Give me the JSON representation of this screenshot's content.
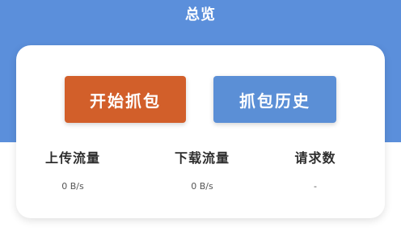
{
  "header": {
    "title": "总览"
  },
  "actions": {
    "start_capture_label": "开始抓包",
    "capture_history_label": "抓包历史"
  },
  "stats": {
    "upload": {
      "label": "上传流量",
      "value": "0 B/s"
    },
    "download": {
      "label": "下载流量",
      "value": "0 B/s"
    },
    "requests": {
      "label": "请求数",
      "value": "-"
    }
  },
  "colors": {
    "header_background": "#5b8fdb",
    "start_button": "#d25f2a",
    "history_button": "#5b8fd6"
  }
}
